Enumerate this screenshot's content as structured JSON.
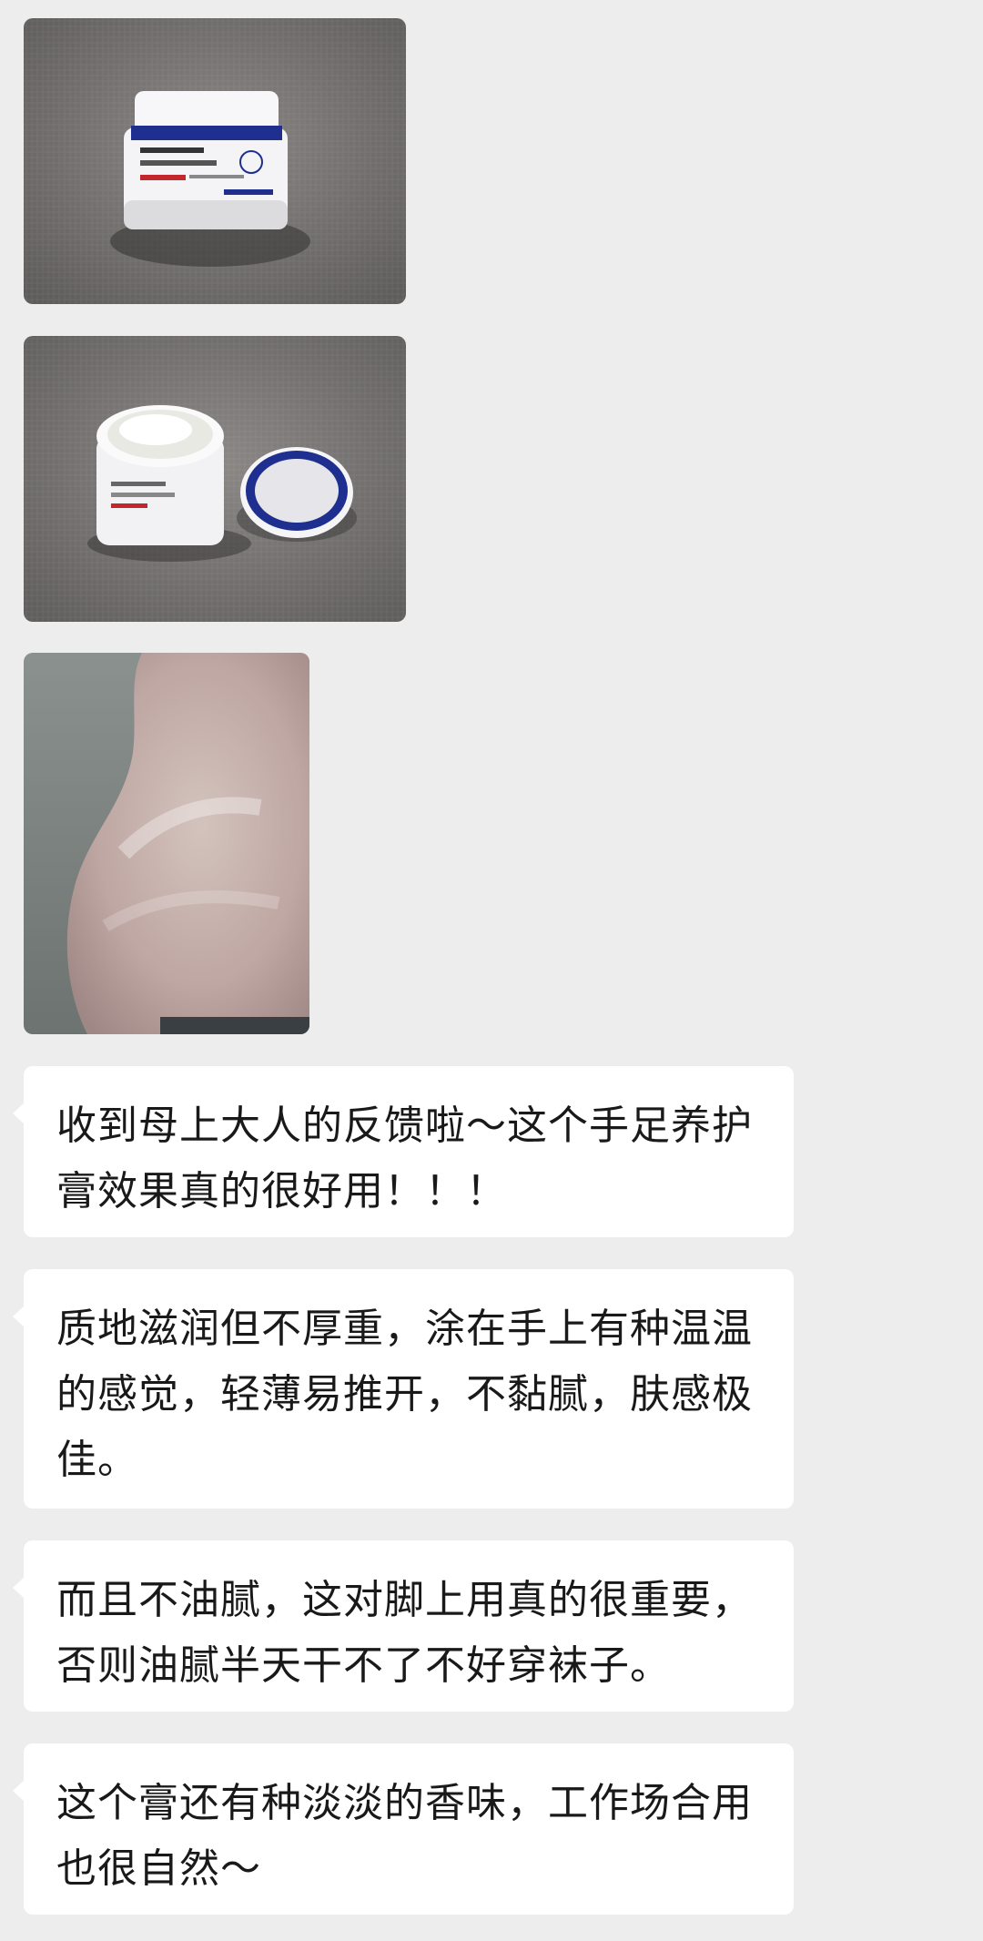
{
  "messages": [
    {
      "type": "image",
      "icon": "hand-foot-cream-jar-closed-photo"
    },
    {
      "type": "image",
      "icon": "hand-foot-cream-jar-open-photo"
    },
    {
      "type": "image",
      "icon": "heel-with-cream-photo"
    },
    {
      "type": "text",
      "text": "收到母上大人的反馈啦～这个手足养护膏效果真的很好用！！！"
    },
    {
      "type": "text",
      "text": "质地滋润但不厚重，涂在手上有种温温的感觉，轻薄易推开，不黏腻，肤感极佳。"
    },
    {
      "type": "text",
      "text": "而且不油腻，这对脚上用真的很重要，否则油腻半天干不了不好穿袜子。"
    },
    {
      "type": "text",
      "text": "这个膏还有种淡淡的香味，工作场合用也很自然～"
    }
  ],
  "colors": {
    "background": "#ededed",
    "bubble": "#ffffff",
    "text": "#191919",
    "jar_lid_band": "#1f2f8f"
  }
}
